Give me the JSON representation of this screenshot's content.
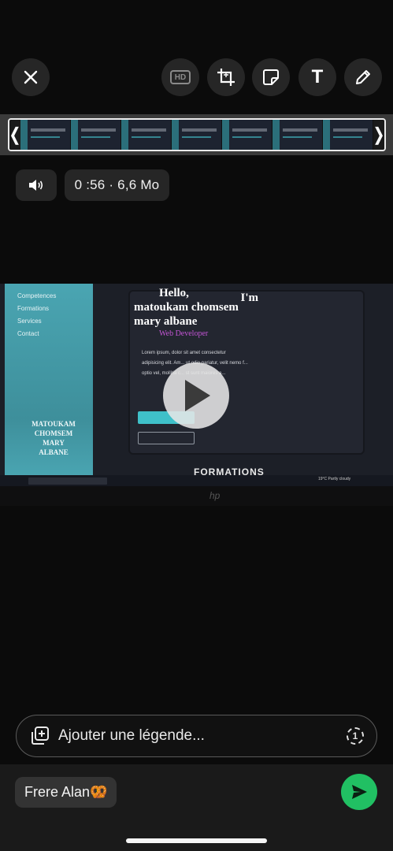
{
  "toolbar": {
    "close_icon": "close-icon",
    "hd_label": "HD",
    "crop_icon": "crop-rotate-icon",
    "sticker_icon": "sticker-icon",
    "text_label": "T",
    "draw_icon": "pencil-icon"
  },
  "trim": {
    "left_handle": "❬",
    "right_handle": "❭"
  },
  "media_info": {
    "sound_icon": "speaker-icon",
    "duration_size": "0 :56 · 6,6 Mo"
  },
  "video_preview": {
    "side_nav": [
      "Competences",
      "Formations",
      "Services",
      "Contact"
    ],
    "side_name": [
      "MATOUKAM",
      "CHOMSEM",
      "MARY",
      "ALBANE"
    ],
    "hello_line1": "Hello,",
    "hello_right": "I'm",
    "hello_line2": "matoukam  chomsem",
    "hello_line3": "mary albane",
    "role": "Web Developer",
    "lorem": "Lorem ipsum, dolor sit amet consectetur adipisicing elit. Am... ut odio pariatur, velit nemo f... optio vel, mollitia c... st sunt maiores a...",
    "section_heading": "FORMATIONS",
    "taskbar_search": "Taper ici pour",
    "status": "19°C  Partly cloudy"
  },
  "caption": {
    "placeholder": "Ajouter une légende...",
    "view_once_label": "1"
  },
  "recipient": {
    "chip_label": "Frere Alan🥨"
  },
  "colors": {
    "send": "#21c063",
    "accent_teal": "#46c4cf",
    "role_purple": "#c455d6"
  }
}
